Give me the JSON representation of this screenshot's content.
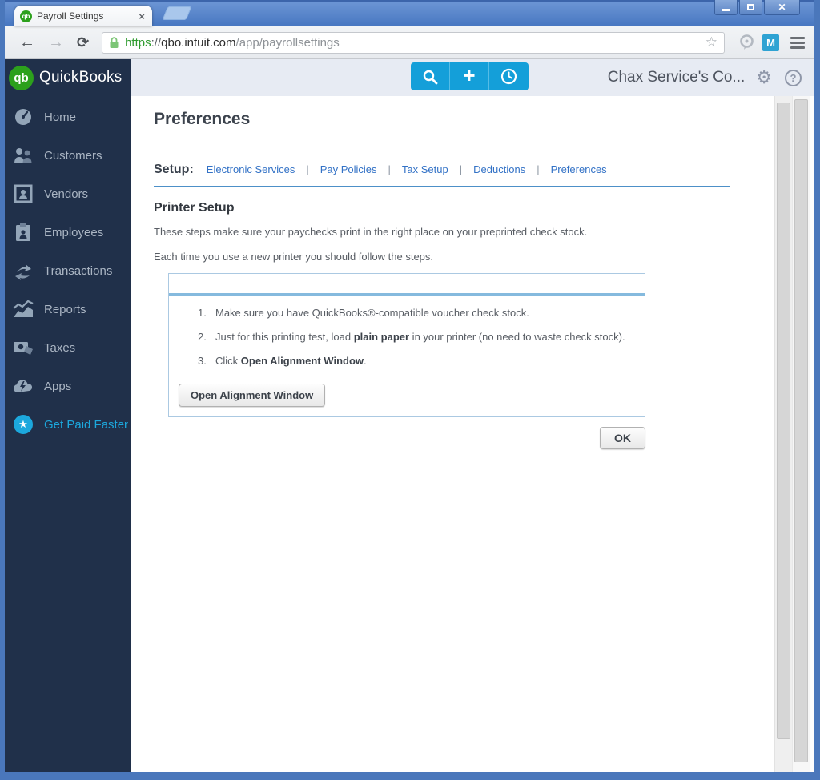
{
  "browser": {
    "tab_title": "Payroll Settings",
    "favicon_text": "qb",
    "url": {
      "scheme": "https",
      "separator": "://",
      "domain": "qbo.intuit.com",
      "path": "/app/payrollsettings"
    },
    "extension_m_label": "M"
  },
  "icons": {
    "back": "←",
    "forward": "→",
    "reload": "⟳",
    "star": "☆",
    "tab_close": "×",
    "window_close": "✕",
    "gear": "⚙",
    "help": "?",
    "plus": "+",
    "gpf_star": "★"
  },
  "sidebar": {
    "logo_badge": "qb",
    "logo_text": "QuickBooks",
    "items": [
      {
        "label": "Home"
      },
      {
        "label": "Customers"
      },
      {
        "label": "Vendors"
      },
      {
        "label": "Employees"
      },
      {
        "label": "Transactions"
      },
      {
        "label": "Reports"
      },
      {
        "label": "Taxes"
      },
      {
        "label": "Apps"
      },
      {
        "label": "Get Paid Faster"
      }
    ]
  },
  "header": {
    "company_name": "Chax Service's Co..."
  },
  "main": {
    "title": "Preferences",
    "setup_label": "Setup:",
    "setup_separator": "|",
    "setup_links": [
      "Electronic Services",
      "Pay Policies",
      "Tax Setup",
      "Deductions",
      "Preferences"
    ],
    "section_title": "Printer Setup",
    "intro1": "These steps make sure your paychecks print in the right place on your preprinted check stock.",
    "intro2": "Each time you use a new printer you should follow the steps.",
    "steps": [
      {
        "num": "1.",
        "pre": "Make sure you have QuickBooks®-compatible voucher check stock.",
        "bold": "",
        "post": ""
      },
      {
        "num": "2.",
        "pre": "Just for this printing test, load ",
        "bold": "plain paper",
        "post": " in your printer (no need to waste check stock)."
      },
      {
        "num": "3.",
        "pre": "Click ",
        "bold": "Open Alignment Window",
        "post": "."
      }
    ],
    "open_alignment_button": "Open Alignment Window",
    "ok_button": "OK"
  },
  "colors": {
    "accent_blue": "#149fd9",
    "link_blue": "#3372c6",
    "qb_green": "#2ca01c",
    "sidebar_navy": "#20304a",
    "titlebar_blue": "#4777c1",
    "divider_blue": "#4d90c8"
  }
}
